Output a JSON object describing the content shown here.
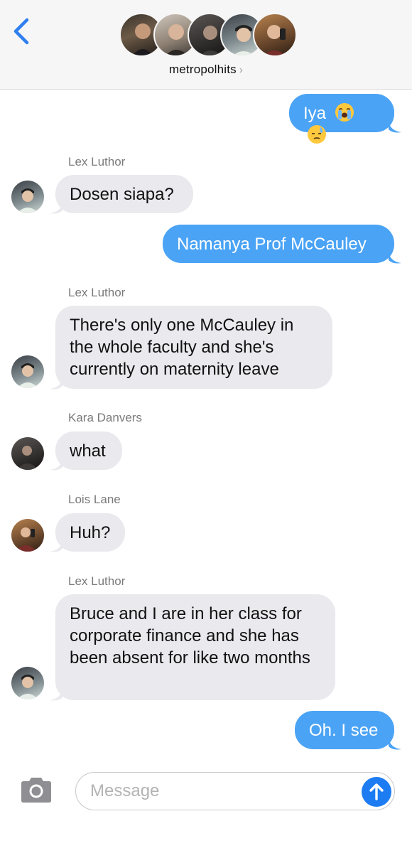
{
  "header": {
    "group_name": "metropolhits",
    "chevron": "›"
  },
  "messages": [
    {
      "type": "out",
      "text": "Iya",
      "emojis": [
        "loudly-crying-face-emoji",
        "downcast-sweat-face-emoji"
      ]
    },
    {
      "type": "in",
      "sender": "Lex Luthor",
      "text": "Dosen siapa?"
    },
    {
      "type": "out",
      "text": "Namanya Prof McCauley"
    },
    {
      "type": "in",
      "sender": "Lex Luthor",
      "text": "There's only one McCauley in the whole faculty and she's currently on maternity leave"
    },
    {
      "type": "in",
      "sender": "Kara Danvers",
      "text": "what"
    },
    {
      "type": "in",
      "sender": "Lois Lane",
      "text": "Huh?"
    },
    {
      "type": "in",
      "sender": "Lex Luthor",
      "text": "Bruce and I are in her class for corporate finance and she has been absent for like two months"
    },
    {
      "type": "out",
      "text": "Oh. I see"
    }
  ],
  "composer": {
    "placeholder": "Message",
    "value": ""
  },
  "colors": {
    "outgoing_bubble": "#4aa3f5",
    "incoming_bubble": "#e9e9ee",
    "accent": "#1d7cf2",
    "back_icon": "#2f7ff0"
  }
}
